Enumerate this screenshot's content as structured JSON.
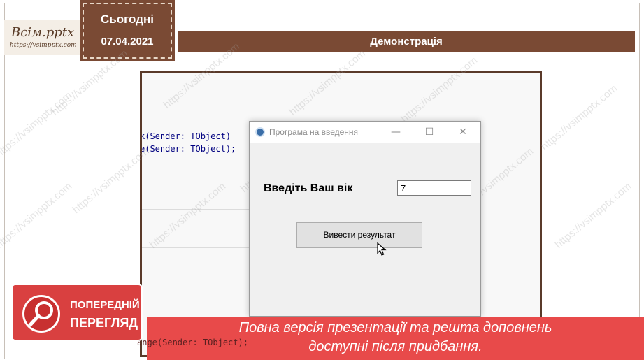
{
  "logo": {
    "title": "Всім.pptx",
    "url": "https://vsimpptx.com"
  },
  "date": {
    "label": "Сьогодні",
    "value": "07.04.2021"
  },
  "slide_title": "Демонстрація",
  "code": {
    "line1_tail": "k(Sender: TObject)",
    "line2_tail": "e(Sender: TObject);",
    "line3_tail": "ange(Sender: TObject);"
  },
  "window": {
    "title": "Програма на введення",
    "min_glyph": "—",
    "max_glyph": "☐",
    "close_glyph": "✕",
    "age_label": "Введіть Ваш вік",
    "age_value": "7",
    "button_label": "Вивести результат"
  },
  "watermark": "https://vsimpptx.com",
  "badge": {
    "line1": "ПОПЕРЕДНІЙ",
    "line2": "ПЕРЕГЛЯД"
  },
  "banner": {
    "line1": "Повна версія презентації та решта доповнень",
    "line2": "доступні після придбання."
  },
  "colors": {
    "brown": "#7a4a34",
    "red": "#e84a4a",
    "badge": "#d94040"
  }
}
